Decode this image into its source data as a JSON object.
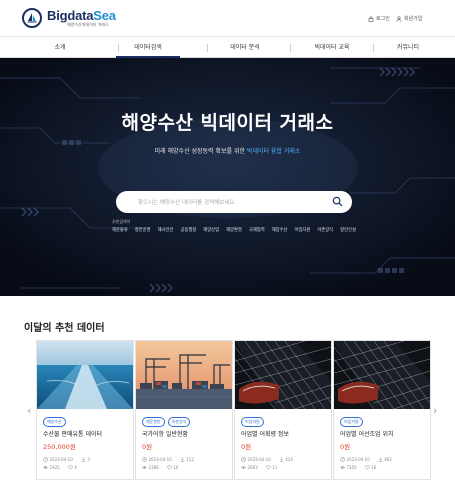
{
  "brand": {
    "name_main": "Bigdata",
    "name_accent": "Sea",
    "tagline": "해양수산빅데이터 거래소"
  },
  "header": {
    "login": "로그인",
    "signup": "회원가입"
  },
  "nav": {
    "items": [
      {
        "label": "소개",
        "active": false
      },
      {
        "label": "데이터검색",
        "active": true
      },
      {
        "label": "데이터 분석",
        "active": false
      },
      {
        "label": "빅데이터 교육",
        "active": false
      },
      {
        "label": "커뮤니티",
        "active": false
      }
    ]
  },
  "hero": {
    "title": "해양수산 빅데이터 거래소",
    "subtitle_pre": "미래 해양수산 성장동력 확보를 위한",
    "subtitle_highlight": "빅데이터 융합 거래소",
    "search_placeholder": "찾으시는 해양수산 데이터를 검색해보세요.",
    "keyword_label": "추천검색어",
    "keywords": [
      "해운물류",
      "항만운영",
      "해사안전",
      "공동행정",
      "해양산업",
      "해양환경",
      "국제협력",
      "해양수산",
      "어업자원",
      "어촌양식",
      "항만건설"
    ]
  },
  "recommend": {
    "title": "이달의 추천 데이터",
    "cards": [
      {
        "tags": [
          "해양수산"
        ],
        "title": "수산물 판매유통 데이터",
        "price": "250,000원",
        "date": "2023-04-10",
        "downloads": "3",
        "views": "1925",
        "likes": "4",
        "image": "sea-wake"
      },
      {
        "tags": [
          "해운항만",
          "어촌양식"
        ],
        "title": "국가어항 일반현황",
        "price": "0원",
        "date": "2023-04-10",
        "downloads": "112",
        "views": "2366",
        "likes": "10",
        "image": "port-cranes"
      },
      {
        "tags": [
          "어업자원"
        ],
        "title": "어업별 어획량 정보",
        "price": "0원",
        "date": "2023-04-10",
        "downloads": "414",
        "views": "2663",
        "likes": "11",
        "image": "fishing-net"
      },
      {
        "tags": [
          "어업자원"
        ],
        "title": "어업별 어선조업 위치",
        "price": "0원",
        "date": "2023-04-10",
        "downloads": "482",
        "views": "7355",
        "likes": "16",
        "image": "fishing-net"
      }
    ]
  },
  "colors": {
    "brand_navy": "#1b2f63",
    "brand_blue": "#1f8fd6",
    "hero_bg": "#0c1322",
    "tag_blue": "#2f6fd6",
    "price_red": "#e0402f"
  }
}
